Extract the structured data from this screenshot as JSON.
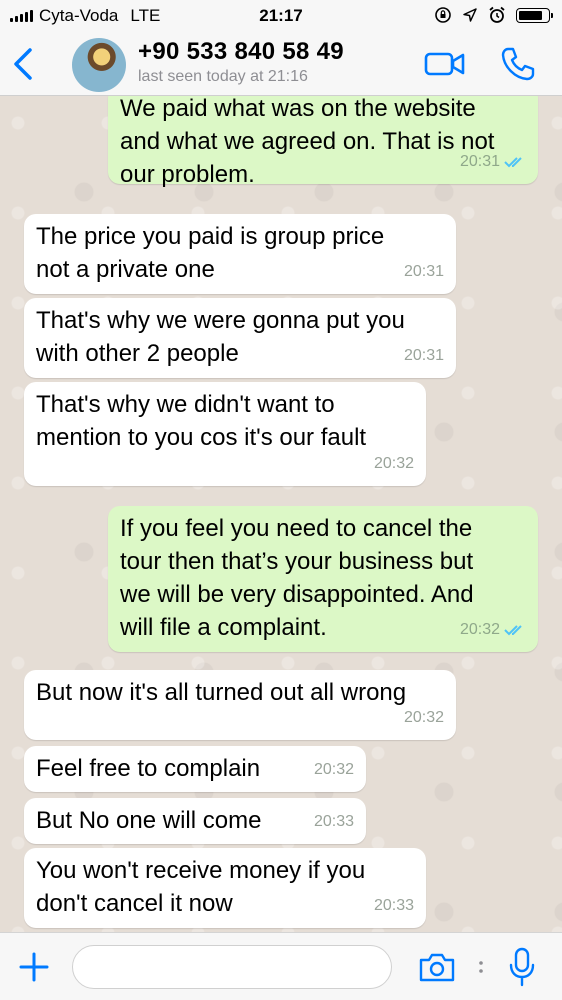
{
  "status_bar": {
    "carrier": "Cyta-Voda",
    "network": "LTE",
    "time": "21:17",
    "battery_level": 0.85
  },
  "header": {
    "contact_name": "+90 533 840 58 49",
    "contact_status": "last seen today at 21:16"
  },
  "messages": [
    {
      "direction": "out",
      "text": "We paid what was on the website\nand what we agreed on. That is not\nour problem.",
      "time": "20:31",
      "read": true
    },
    {
      "direction": "in",
      "text": "The price you paid is group price\nnot a private one",
      "time": "20:31"
    },
    {
      "direction": "in",
      "text": "That's why we were gonna put you\nwith other 2 people",
      "time": "20:31"
    },
    {
      "direction": "in",
      "text": "That's why we didn't want to\nmention to you cos it's our fault",
      "time": "20:32"
    },
    {
      "direction": "out",
      "text": "If you feel you need to cancel the\ntour then that’s your business but\nwe will be very disappointed. And\nwill file a complaint.",
      "time": "20:32",
      "read": true
    },
    {
      "direction": "in",
      "text": "But now it's all turned out all wrong",
      "time": "20:32"
    },
    {
      "direction": "in",
      "text": "Feel free to complain",
      "time": "20:32"
    },
    {
      "direction": "in",
      "text": "But No one will come",
      "time": "20:33"
    },
    {
      "direction": "in",
      "text": "You won't receive money if you\ndon't cancel it now",
      "time": "20:33"
    }
  ],
  "input": {
    "value": "",
    "placeholder": ""
  },
  "colors": {
    "accent": "#007aff",
    "outgoing_bubble": "#dcf8c6",
    "incoming_bubble": "#ffffff",
    "read_ticks": "#4fc3f7",
    "chat_background": "#e5ddd5"
  },
  "icons": [
    "back-chevron-icon",
    "video-call-icon",
    "phone-icon",
    "plus-icon",
    "camera-icon",
    "microphone-icon"
  ]
}
